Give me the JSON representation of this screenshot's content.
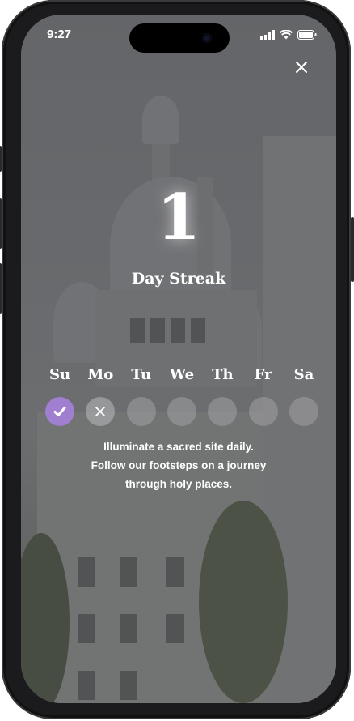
{
  "status_bar": {
    "time": "9:27"
  },
  "streak": {
    "count": "1",
    "label": "Day Streak"
  },
  "days": [
    {
      "label": "Su",
      "state": "done",
      "icon": "check-icon"
    },
    {
      "label": "Mo",
      "state": "missed",
      "icon": "x-icon"
    },
    {
      "label": "Tu",
      "state": "upcoming",
      "icon": ""
    },
    {
      "label": "We",
      "state": "upcoming",
      "icon": ""
    },
    {
      "label": "Th",
      "state": "upcoming",
      "icon": ""
    },
    {
      "label": "Fr",
      "state": "upcoming",
      "icon": ""
    },
    {
      "label": "Sa",
      "state": "upcoming",
      "icon": ""
    }
  ],
  "message": {
    "line1": "Illuminate a sacred site daily.",
    "line2": "Follow our footsteps on a journey",
    "line3": "through holy places."
  },
  "colors": {
    "done": "#a07ed0",
    "text": "#ffffff"
  }
}
